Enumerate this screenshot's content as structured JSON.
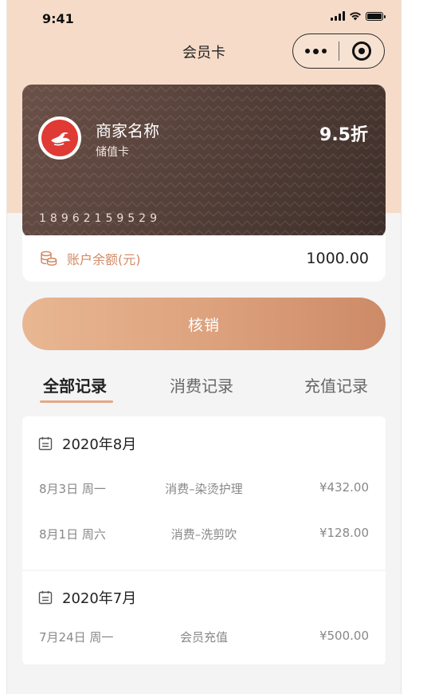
{
  "status_bar": {
    "time": "9:41"
  },
  "nav": {
    "title": "会员卡"
  },
  "card": {
    "merchant_name": "商家名称",
    "card_type": "储值卡",
    "discount": "9.5折",
    "card_number": "18962159529"
  },
  "balance": {
    "label": "账户余额(元)",
    "value": "1000.00"
  },
  "action_button": {
    "label": "核销"
  },
  "tabs": [
    {
      "label": "全部记录",
      "active": true
    },
    {
      "label": "消费记录",
      "active": false
    },
    {
      "label": "充值记录",
      "active": false
    }
  ],
  "records": [
    {
      "month": "2020年8月",
      "items": [
        {
          "date": "8月3日 周一",
          "desc": "消费–染烫护理",
          "amount": "¥432.00"
        },
        {
          "date": "8月1日 周六",
          "desc": "消费–洗剪吹",
          "amount": "¥128.00"
        }
      ]
    },
    {
      "month": "2020年7月",
      "items": [
        {
          "date": "7月24日 周一",
          "desc": "会员充值",
          "amount": "¥500.00"
        }
      ]
    }
  ],
  "colors": {
    "header_bg": "#f6dcc8",
    "accent": "#e3a883",
    "card_bg": "#56413a",
    "balance_label": "#d18a65"
  },
  "icons": {
    "status": [
      "signal-icon",
      "wifi-icon",
      "battery-icon"
    ],
    "capsule": [
      "more-icon",
      "close-icon"
    ],
    "logo": "bird-logo-icon",
    "balance": "coins-icon",
    "month": "calendar-icon"
  }
}
